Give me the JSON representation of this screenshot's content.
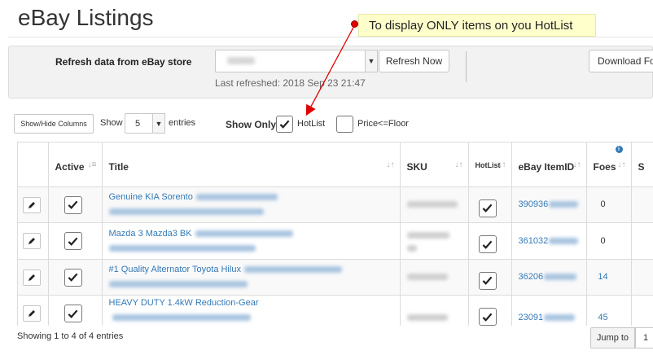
{
  "page": {
    "title": "eBay Listings"
  },
  "callout": {
    "text": "To display ONLY items on you HotList"
  },
  "toolbar": {
    "refresh_label": "Refresh data from eBay store",
    "refresh_button": "Refresh Now",
    "last_refreshed": "Last refreshed: 2018 Sep 23 21:47",
    "download_button": "Download Fo"
  },
  "controls": {
    "show_hide_columns": "Show/Hide Columns",
    "show": "Show",
    "entries_value": "5",
    "entries": "entries",
    "show_only": "Show Only",
    "hotlist": "HotList",
    "price_floor": "Price<=Floor"
  },
  "table": {
    "headers": {
      "active": "Active",
      "title": "Title",
      "sku": "SKU",
      "hotlist": "HotList",
      "item_id": "eBay ItemID",
      "foes": "Foes",
      "extra": "S"
    },
    "rows": [
      {
        "title": "Genuine KIA Sorento",
        "item_id": "390936",
        "foes": "0",
        "foes_link": false
      },
      {
        "title": "Mazda 3 Mazda3 BK",
        "item_id": "361032",
        "foes": "0",
        "foes_link": false
      },
      {
        "title": "#1 Quality Alternator Toyota Hilux",
        "item_id": "36206",
        "foes": "14",
        "foes_link": true
      },
      {
        "title": "HEAVY DUTY 1.4kW Reduction-Gear",
        "item_id": "23091",
        "foes": "45",
        "foes_link": true
      }
    ]
  },
  "footer": {
    "showing": "Showing 1 to 4 of 4 entries",
    "jump_to": "Jump to",
    "page_value": "1"
  },
  "colors": {
    "link": "#337ab7",
    "callout_bg": "#ffffcc",
    "arrow": "#e00000"
  }
}
